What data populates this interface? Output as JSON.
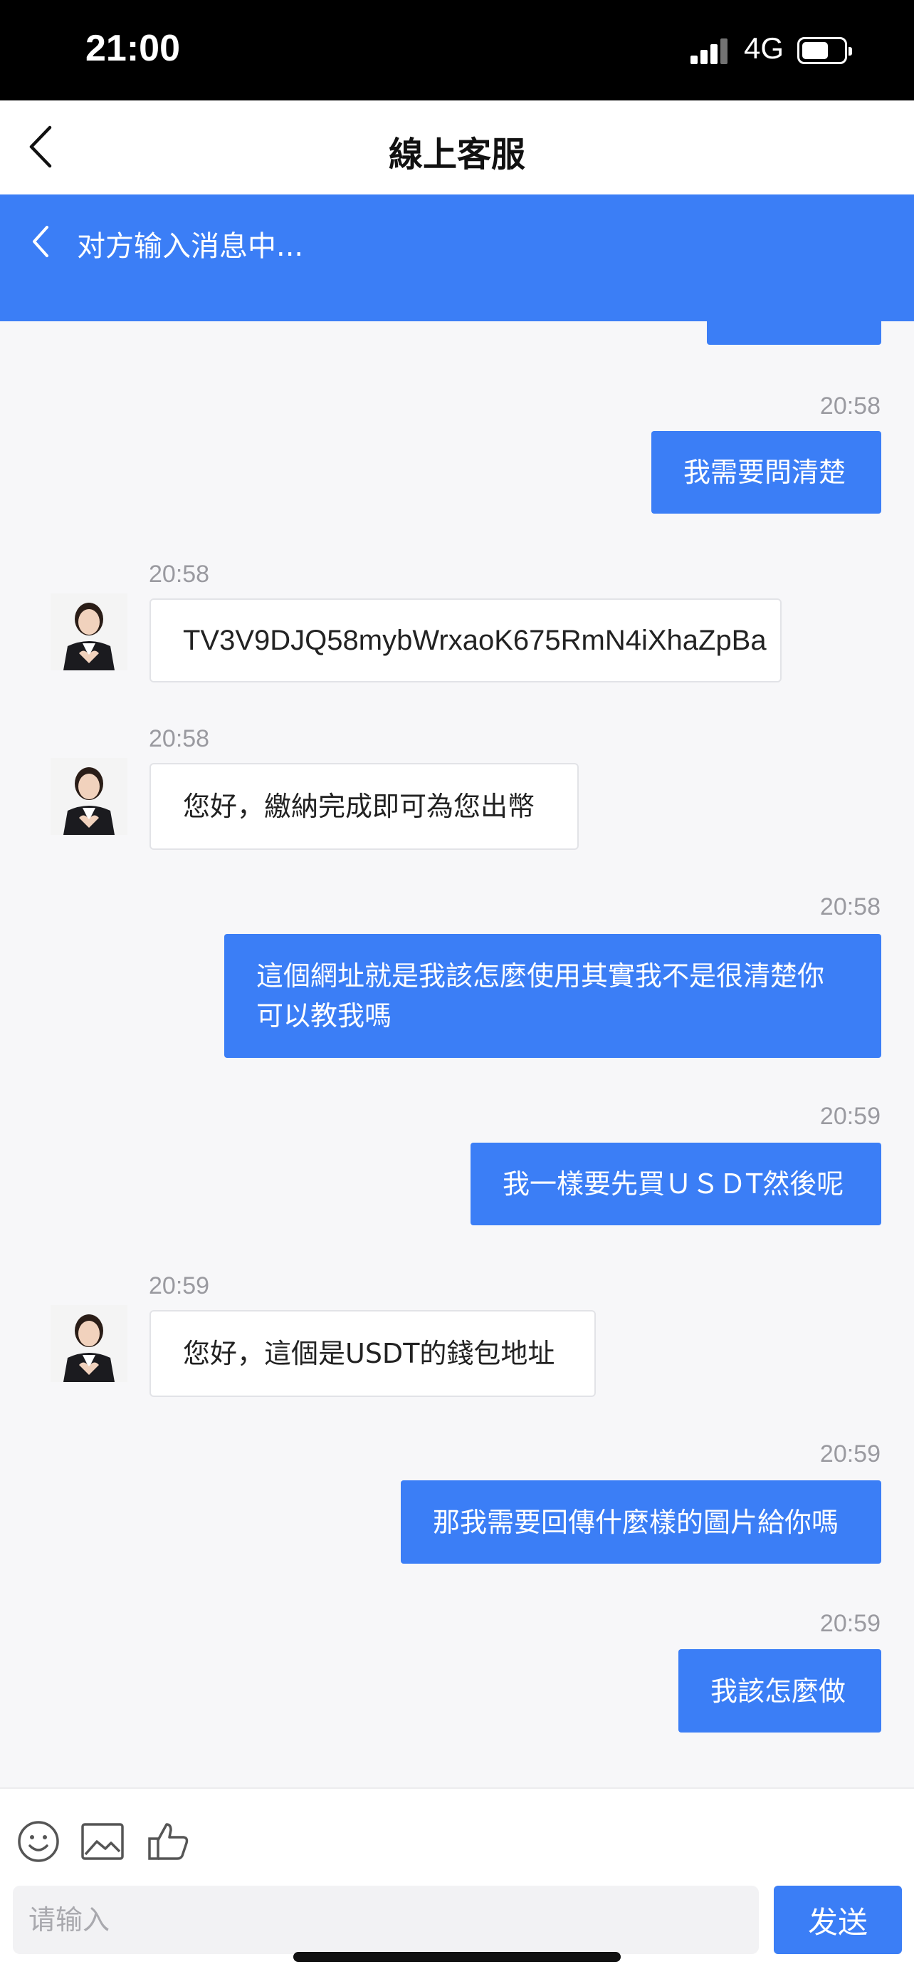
{
  "status_bar": {
    "time": "21:00",
    "network": "4G"
  },
  "nav": {
    "title": "線上客服"
  },
  "typing_banner": {
    "text": "对方输入消息中..."
  },
  "messages": [
    {
      "direction": "out",
      "time": "20:58",
      "text": "我需要問清楚"
    },
    {
      "direction": "in",
      "time": "20:58",
      "text": "TV3V9DJQ58mybWrxaoK675RmN4iXhaZpBa"
    },
    {
      "direction": "in",
      "time": "20:58",
      "text": "您好，繳納完成即可為您出幣"
    },
    {
      "direction": "out",
      "time": "20:58",
      "text": "這個網址就是我該怎麼使用其實我不是很清楚你可以教我嗎"
    },
    {
      "direction": "out",
      "time": "20:59",
      "text": "我一樣要先買ＵＳＤT然後呢"
    },
    {
      "direction": "in",
      "time": "20:59",
      "text": "您好，這個是USDT的錢包地址"
    },
    {
      "direction": "out",
      "time": "20:59",
      "text": "那我需要回傳什麼樣的圖片給你嗎"
    },
    {
      "direction": "out",
      "time": "20:59",
      "text": "我該怎麼做"
    }
  ],
  "composer": {
    "tools": [
      "emoji-icon",
      "image-icon",
      "thumbs-up-icon"
    ],
    "input_placeholder": "请输入",
    "input_value": "",
    "send_label": "发送"
  },
  "colors": {
    "accent": "#3b7ef6",
    "background": "#f7f7f9"
  }
}
